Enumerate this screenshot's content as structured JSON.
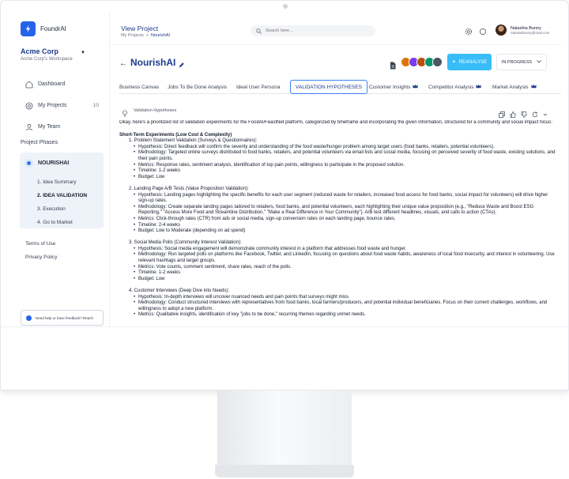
{
  "brand": {
    "name": "FoundrAI"
  },
  "org": {
    "name": "Acme Corp",
    "workspace": "Acme Corp's Workspace"
  },
  "nav": [
    {
      "label": "Dashboard",
      "count": ""
    },
    {
      "label": "My Projects",
      "count": "10"
    },
    {
      "label": "My Team",
      "count": ""
    }
  ],
  "project_phases": {
    "title": "Project Phases",
    "project": "NOURISHAI",
    "items": [
      "1. Idea Summary",
      "2. IDEA VALIDATION",
      "3. Execution",
      "4. Go to Market"
    ]
  },
  "links": [
    "Terms of Use",
    "Privacy Policy"
  ],
  "help": "Need help or have feedback? Reach",
  "header": {
    "title": "View Project",
    "breadcrumb": [
      "My Projects",
      ">",
      "NourishAI"
    ],
    "search_placeholder": "Search here...",
    "user_name": "Natashia Bunny",
    "user_email": "natasiabunny@mail.com"
  },
  "project": {
    "title": "NourishAI",
    "reanalyse": "REANALYSE",
    "status": "IN PROGRESS"
  },
  "tabs": [
    "Business Canvas",
    "Jobs To Be Done Analysis",
    "Ideal User Persona",
    "VALIDATION HYPOTHESES",
    "Customer Insights",
    "Competitor Analysis",
    "Market Analysis"
  ],
  "content": {
    "label": "Validation Hypotheses",
    "intro": "Okay, here's a prioritized list of validation experiments for the FoodAI/FeastNet platform, categorized by timeframe and incorporating the given information, structured for a community and social impact focus:",
    "section": "Short-Term Experiments (Low Cost & Complexity)",
    "experiments": [
      {
        "title": "1. Problem Statement Validation (Surveys & Questionnaires):",
        "bullets": [
          "Hypothesis: Direct feedback will confirm the severity and understanding of the food waste/hunger problem among target users (food banks, retailers, potential volunteers).",
          "Methodology: Targeted online surveys distributed to food banks, retailers, and potential volunteers via email lists and social media, focusing on perceived severity of food waste, existing solutions, and their pain points.",
          "Metrics: Response rates, sentiment analysis, identification of top pain points, willingness to participate in the proposed solution.",
          "Timeline: 1-2 weeks",
          "Budget: Low"
        ]
      },
      {
        "title": "2. Landing Page A/B Tests (Value Proposition Validation):",
        "bullets": [
          "Hypothesis: Landing pages highlighting the specific benefits for each user segment (reduced waste for retailers, increased food access for food banks, social impact for volunteers) will drive higher sign-up rates.",
          "Methodology: Create separate landing pages tailored to retailers, food banks, and potential volunteers, each highlighting their unique value proposition (e.g., \"Reduce Waste and Boost ESG Reporting,\" \"Access More Food and Streamline Distribution,\" \"Make a Real Difference in Your Community\"). A/B test different headlines, visuals, and calls to action (CTAs).",
          "Metrics: Click-through rates (CTR) from ads or social media, sign-up conversion rates on each landing page, bounce rates.",
          "Timeline: 2-4 weeks",
          "Budget: Low to Moderate (depending on ad spend)"
        ]
      },
      {
        "title": "3. Social Media Polls (Community Interest Validation):",
        "bullets": [
          "Hypothesis: Social media engagement will demonstrate community interest in a platform that addresses food waste and hunger.",
          "Methodology: Run targeted polls on platforms like Facebook, Twitter, and LinkedIn, focusing on questions about food waste habits, awareness of local food insecurity, and interest in volunteering. Use relevant hashtags and target groups.",
          "Metrics: Vote counts, comment sentiment, share rates, reach of the polls.",
          "Timeline: 1-2 weeks",
          "Budget: Low"
        ]
      },
      {
        "title": "4. Customer Interviews (Deep Dive into Needs):",
        "bullets": [
          "Hypothesis: In-depth interviews will uncover nuanced needs and pain points that surveys might miss.",
          "Methodology: Conduct structured interviews with representatives from food banks, local farmers/producers, and potential individual beneficiaries. Focus on their current challenges, workflows, and willingness to adopt a new platform.",
          "Metrics: Qualitative insights, identification of key \"jobs to be done,\" recurring themes regarding unmet needs."
        ]
      }
    ]
  },
  "colors": {
    "primary": "#1f3a8a",
    "accent": "#38bdf8",
    "brand": "#2563eb",
    "crown": "#1e3a8a"
  }
}
